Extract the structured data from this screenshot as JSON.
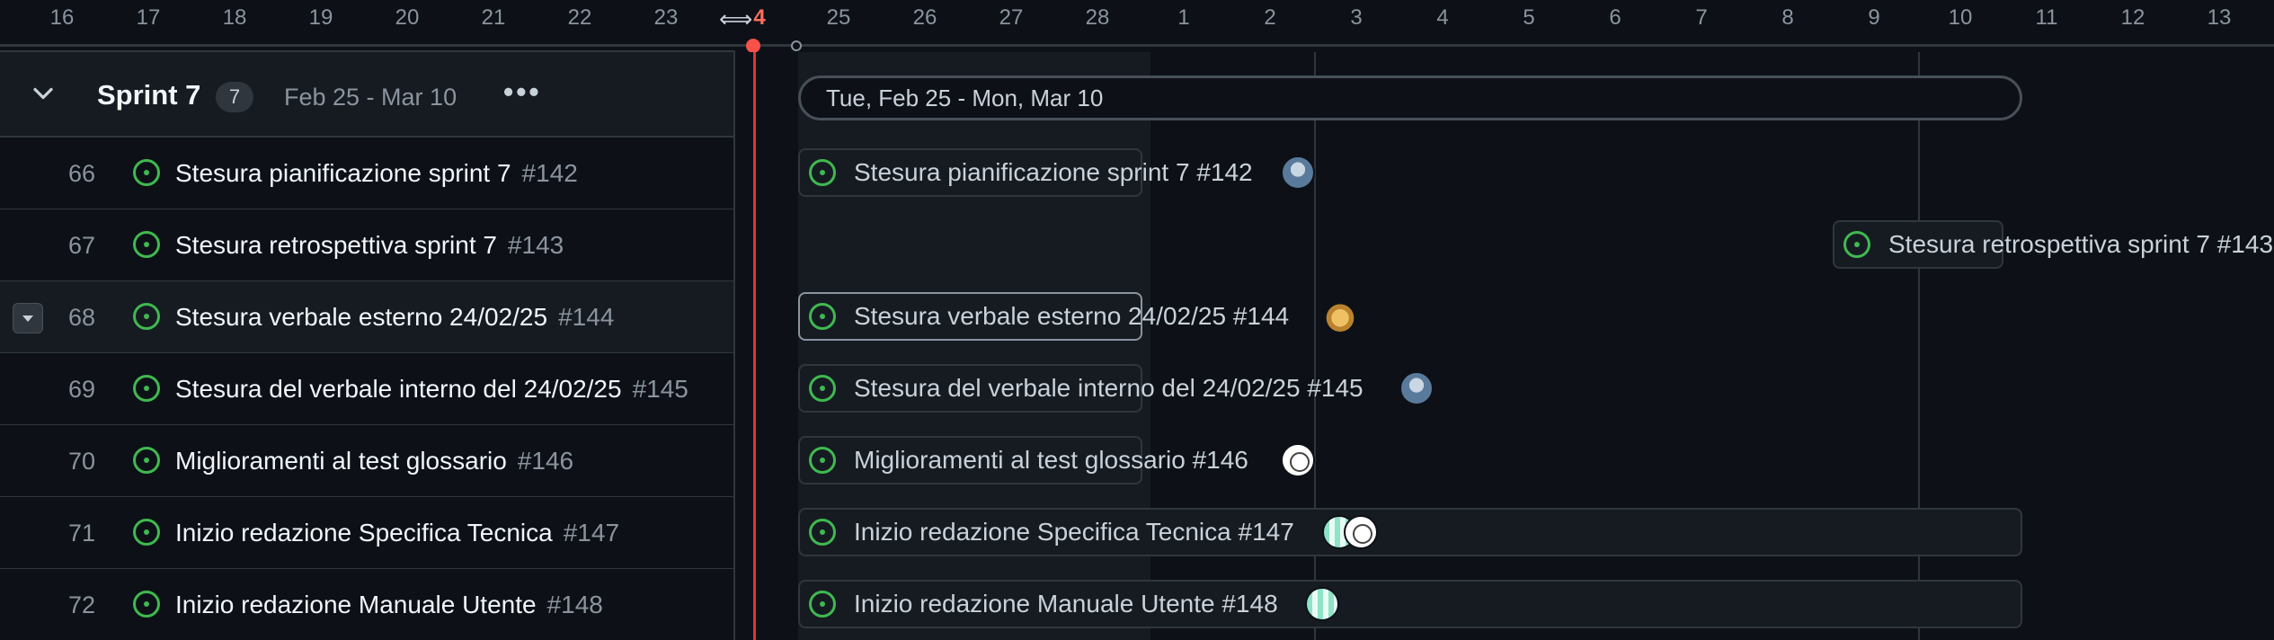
{
  "header": {
    "dates": [
      "16",
      "17",
      "18",
      "19",
      "20",
      "21",
      "22",
      "23",
      "4",
      "25",
      "26",
      "27",
      "28",
      "1",
      "2",
      "3",
      "4",
      "5",
      "6",
      "7",
      "8",
      "9",
      "10",
      "11",
      "12",
      "13"
    ],
    "today_index": 8
  },
  "group": {
    "title": "Sprint 7",
    "count": "7",
    "dates": "Feb 25 - Mar 10",
    "menu": "•••",
    "bar_label": "Tue, Feb 25 - Mon, Mar 10"
  },
  "rows": [
    {
      "num": "66",
      "title": "Stesura pianificazione sprint 7",
      "ref": "#142",
      "bar_label": "Stesura pianificazione sprint 7 #142"
    },
    {
      "num": "67",
      "title": "Stesura retrospettiva sprint 7",
      "ref": "#143",
      "bar_label": "Stesura retrospettiva sprint 7 #143"
    },
    {
      "num": "68",
      "title": "Stesura verbale esterno 24/02/25",
      "ref": "#144",
      "bar_label": "Stesura verbale esterno 24/02/25 #144"
    },
    {
      "num": "69",
      "title": "Stesura del verbale interno del 24/02/25",
      "ref": "#145",
      "bar_label": "Stesura del verbale interno del 24/02/25 #145"
    },
    {
      "num": "70",
      "title": "Miglioramenti al test glossario",
      "ref": "#146",
      "bar_label": "Miglioramenti al test glossario #146"
    },
    {
      "num": "71",
      "title": "Inizio redazione Specifica Tecnica",
      "ref": "#147",
      "bar_label": "Inizio redazione Specifica Tecnica #147"
    },
    {
      "num": "72",
      "title": "Inizio redazione Manuale Utente",
      "ref": "#148",
      "bar_label": "Inizio redazione Manuale Utente #148"
    }
  ],
  "icons": {
    "collapse": "chevron-down-icon",
    "issue": "issue-open-icon",
    "resize": "resize-handle-icon"
  },
  "colors": {
    "background": "#0d1117",
    "today": "#f85149",
    "issue_open": "#3fb950",
    "border": "#30363d"
  }
}
